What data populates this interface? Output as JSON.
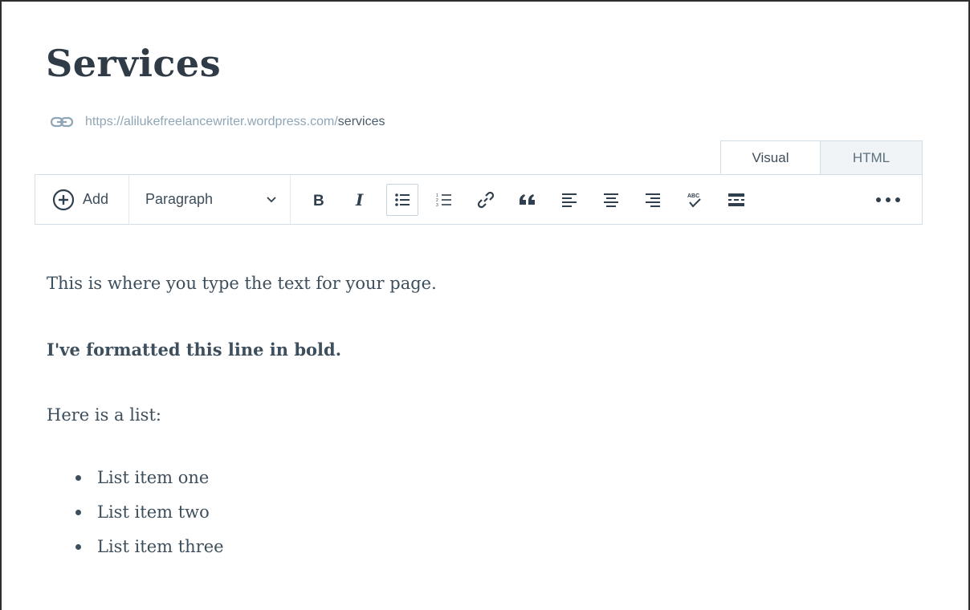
{
  "page": {
    "title": "Services",
    "permalink_base": "https://alilukefreelancewriter.wordpress.com/",
    "permalink_slug": "services"
  },
  "editor_tabs": [
    {
      "label": "Visual",
      "active": true
    },
    {
      "label": "HTML",
      "active": false
    }
  ],
  "toolbar": {
    "add_label": "Add",
    "format_selected": "Paragraph",
    "buttons": [
      {
        "icon": "bold-icon"
      },
      {
        "icon": "italic-icon"
      },
      {
        "icon": "bulleted-list-icon",
        "active": true
      },
      {
        "icon": "numbered-list-icon"
      },
      {
        "icon": "link-icon"
      },
      {
        "icon": "blockquote-icon"
      },
      {
        "icon": "align-left-icon"
      },
      {
        "icon": "align-center-icon"
      },
      {
        "icon": "align-right-icon"
      },
      {
        "icon": "spellcheck-icon"
      },
      {
        "icon": "read-more-icon"
      },
      {
        "icon": "more-options-icon"
      }
    ]
  },
  "content": {
    "paragraph1": "This is where you type the text for your page.",
    "bold_paragraph": "I've formatted this line in bold.",
    "list_intro": "Here is a list:",
    "list_items": [
      "List item one",
      "List item two",
      "List item three"
    ]
  },
  "colors": {
    "text": "#3d4e5c",
    "title": "#2f3b46",
    "permalink_muted": "#8fa6b6",
    "border": "#d6dee5",
    "html_tab_bg": "#f0f4f7"
  }
}
